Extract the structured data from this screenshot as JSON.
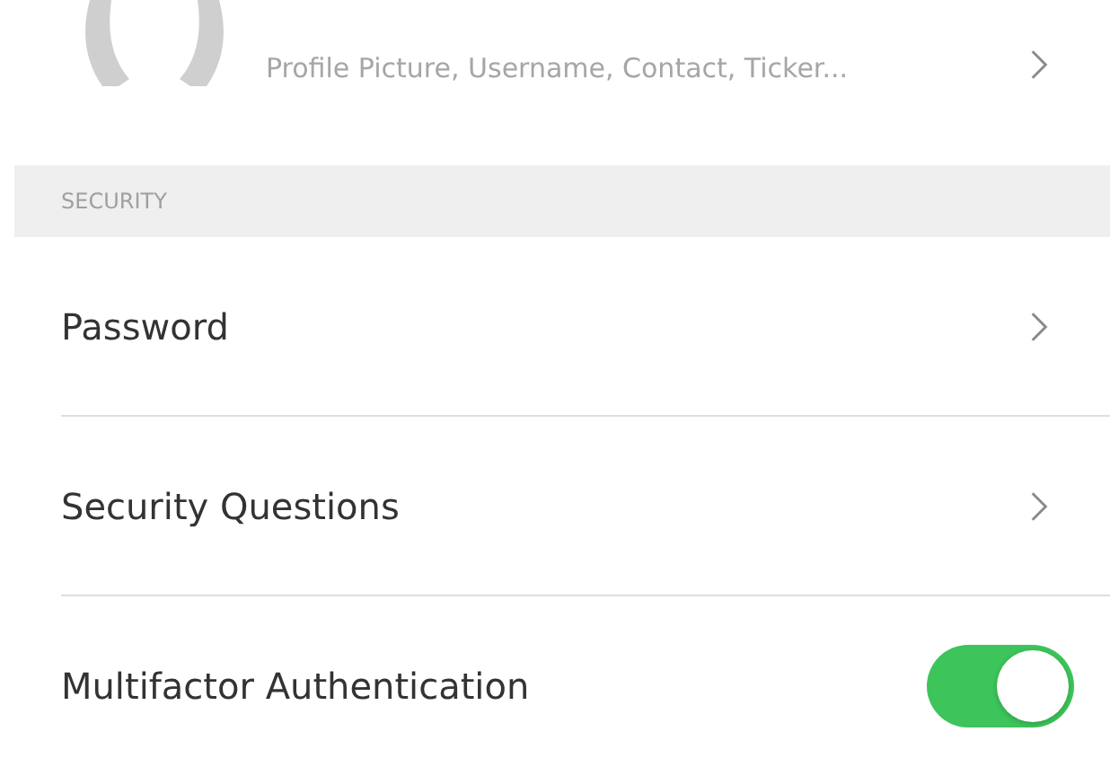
{
  "profile": {
    "subtitle": "Profile Picture, Username, Contact, Ticker..."
  },
  "section": {
    "title": "SECURITY"
  },
  "rows": [
    {
      "kind": "link",
      "label": "Password"
    },
    {
      "kind": "link",
      "label": "Security Questions"
    },
    {
      "kind": "toggle",
      "label": "Multifactor Authentication",
      "on": true
    }
  ]
}
